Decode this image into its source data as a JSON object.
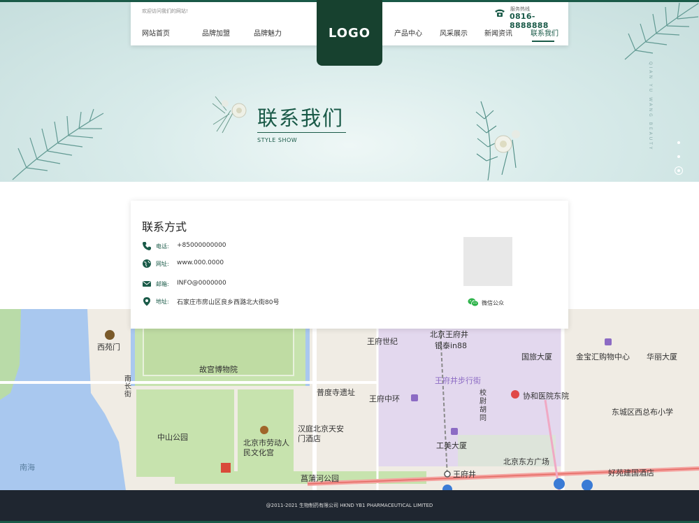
{
  "header": {
    "welcome": "欢迎访问我们的网站!",
    "nav": [
      "网站首页",
      "品牌加盟",
      "品牌魅力",
      "产品中心",
      "风采展示",
      "新闻资讯",
      "联系我们"
    ],
    "logo": "LOGO",
    "phone_label": "服务热线",
    "phone_number": "0816-8888888"
  },
  "banner": {
    "title": "联系我们",
    "subtitle": "STYLE SHOW",
    "vertical_text": "QIAN YU WANG BEAUTY"
  },
  "contact": {
    "title": "联系方式",
    "rows": [
      {
        "icon": "phone-icon",
        "label": "电话:",
        "value": "+85000000000"
      },
      {
        "icon": "globe-icon",
        "label": "网址:",
        "value": "www.000.0000"
      },
      {
        "icon": "mail-icon",
        "label": "邮箱:",
        "value": "INFO@0000000"
      },
      {
        "icon": "location-pin-icon",
        "label": "地址:",
        "value": "石家庄市房山区良乡西潞北大街80号"
      }
    ],
    "wechat_label": "微信公众"
  },
  "map": {
    "labels": [
      "西苑门",
      "故宫博物院",
      "南长街",
      "普度寺遗址",
      "王府世纪",
      "北京王府井",
      "银泰in88",
      "王府井步行街",
      "国旅大厦",
      "金宝汇购物中心",
      "华丽大厦",
      "王府中环",
      "协和医院东院",
      "东城区西总布小学",
      "中山公园",
      "北京市劳动人民文化宫",
      "汉庭北京天安门酒店",
      "校尉胡同",
      "工美大厦",
      "北京东方广场",
      "王府井",
      "好苑建国酒店",
      "菖蒲河公园",
      "南海",
      "东方"
    ]
  },
  "footer": {
    "copyright": "@2011-2021 生物制药有限公司  HKND YB1 PHARMACEUTICAL LIMITED"
  },
  "colors": {
    "brand": "#1a5a48",
    "logo_bg": "#17412f",
    "footer_bg": "#1f2630"
  }
}
